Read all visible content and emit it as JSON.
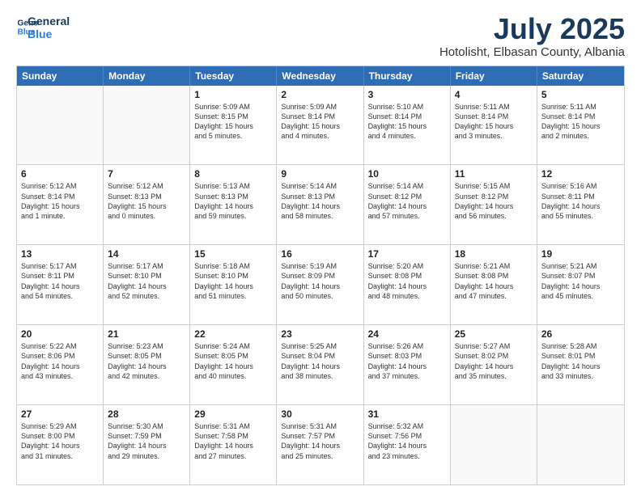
{
  "logo": {
    "line1": "General",
    "line2": "Blue"
  },
  "title": "July 2025",
  "subtitle": "Hotolisht, Elbasan County, Albania",
  "days": [
    "Sunday",
    "Monday",
    "Tuesday",
    "Wednesday",
    "Thursday",
    "Friday",
    "Saturday"
  ],
  "weeks": [
    [
      {
        "day": "",
        "text": ""
      },
      {
        "day": "",
        "text": ""
      },
      {
        "day": "1",
        "text": "Sunrise: 5:09 AM\nSunset: 8:15 PM\nDaylight: 15 hours\nand 5 minutes."
      },
      {
        "day": "2",
        "text": "Sunrise: 5:09 AM\nSunset: 8:14 PM\nDaylight: 15 hours\nand 4 minutes."
      },
      {
        "day": "3",
        "text": "Sunrise: 5:10 AM\nSunset: 8:14 PM\nDaylight: 15 hours\nand 4 minutes."
      },
      {
        "day": "4",
        "text": "Sunrise: 5:11 AM\nSunset: 8:14 PM\nDaylight: 15 hours\nand 3 minutes."
      },
      {
        "day": "5",
        "text": "Sunrise: 5:11 AM\nSunset: 8:14 PM\nDaylight: 15 hours\nand 2 minutes."
      }
    ],
    [
      {
        "day": "6",
        "text": "Sunrise: 5:12 AM\nSunset: 8:14 PM\nDaylight: 15 hours\nand 1 minute."
      },
      {
        "day": "7",
        "text": "Sunrise: 5:12 AM\nSunset: 8:13 PM\nDaylight: 15 hours\nand 0 minutes."
      },
      {
        "day": "8",
        "text": "Sunrise: 5:13 AM\nSunset: 8:13 PM\nDaylight: 14 hours\nand 59 minutes."
      },
      {
        "day": "9",
        "text": "Sunrise: 5:14 AM\nSunset: 8:13 PM\nDaylight: 14 hours\nand 58 minutes."
      },
      {
        "day": "10",
        "text": "Sunrise: 5:14 AM\nSunset: 8:12 PM\nDaylight: 14 hours\nand 57 minutes."
      },
      {
        "day": "11",
        "text": "Sunrise: 5:15 AM\nSunset: 8:12 PM\nDaylight: 14 hours\nand 56 minutes."
      },
      {
        "day": "12",
        "text": "Sunrise: 5:16 AM\nSunset: 8:11 PM\nDaylight: 14 hours\nand 55 minutes."
      }
    ],
    [
      {
        "day": "13",
        "text": "Sunrise: 5:17 AM\nSunset: 8:11 PM\nDaylight: 14 hours\nand 54 minutes."
      },
      {
        "day": "14",
        "text": "Sunrise: 5:17 AM\nSunset: 8:10 PM\nDaylight: 14 hours\nand 52 minutes."
      },
      {
        "day": "15",
        "text": "Sunrise: 5:18 AM\nSunset: 8:10 PM\nDaylight: 14 hours\nand 51 minutes."
      },
      {
        "day": "16",
        "text": "Sunrise: 5:19 AM\nSunset: 8:09 PM\nDaylight: 14 hours\nand 50 minutes."
      },
      {
        "day": "17",
        "text": "Sunrise: 5:20 AM\nSunset: 8:08 PM\nDaylight: 14 hours\nand 48 minutes."
      },
      {
        "day": "18",
        "text": "Sunrise: 5:21 AM\nSunset: 8:08 PM\nDaylight: 14 hours\nand 47 minutes."
      },
      {
        "day": "19",
        "text": "Sunrise: 5:21 AM\nSunset: 8:07 PM\nDaylight: 14 hours\nand 45 minutes."
      }
    ],
    [
      {
        "day": "20",
        "text": "Sunrise: 5:22 AM\nSunset: 8:06 PM\nDaylight: 14 hours\nand 43 minutes."
      },
      {
        "day": "21",
        "text": "Sunrise: 5:23 AM\nSunset: 8:05 PM\nDaylight: 14 hours\nand 42 minutes."
      },
      {
        "day": "22",
        "text": "Sunrise: 5:24 AM\nSunset: 8:05 PM\nDaylight: 14 hours\nand 40 minutes."
      },
      {
        "day": "23",
        "text": "Sunrise: 5:25 AM\nSunset: 8:04 PM\nDaylight: 14 hours\nand 38 minutes."
      },
      {
        "day": "24",
        "text": "Sunrise: 5:26 AM\nSunset: 8:03 PM\nDaylight: 14 hours\nand 37 minutes."
      },
      {
        "day": "25",
        "text": "Sunrise: 5:27 AM\nSunset: 8:02 PM\nDaylight: 14 hours\nand 35 minutes."
      },
      {
        "day": "26",
        "text": "Sunrise: 5:28 AM\nSunset: 8:01 PM\nDaylight: 14 hours\nand 33 minutes."
      }
    ],
    [
      {
        "day": "27",
        "text": "Sunrise: 5:29 AM\nSunset: 8:00 PM\nDaylight: 14 hours\nand 31 minutes."
      },
      {
        "day": "28",
        "text": "Sunrise: 5:30 AM\nSunset: 7:59 PM\nDaylight: 14 hours\nand 29 minutes."
      },
      {
        "day": "29",
        "text": "Sunrise: 5:31 AM\nSunset: 7:58 PM\nDaylight: 14 hours\nand 27 minutes."
      },
      {
        "day": "30",
        "text": "Sunrise: 5:31 AM\nSunset: 7:57 PM\nDaylight: 14 hours\nand 25 minutes."
      },
      {
        "day": "31",
        "text": "Sunrise: 5:32 AM\nSunset: 7:56 PM\nDaylight: 14 hours\nand 23 minutes."
      },
      {
        "day": "",
        "text": ""
      },
      {
        "day": "",
        "text": ""
      }
    ]
  ]
}
